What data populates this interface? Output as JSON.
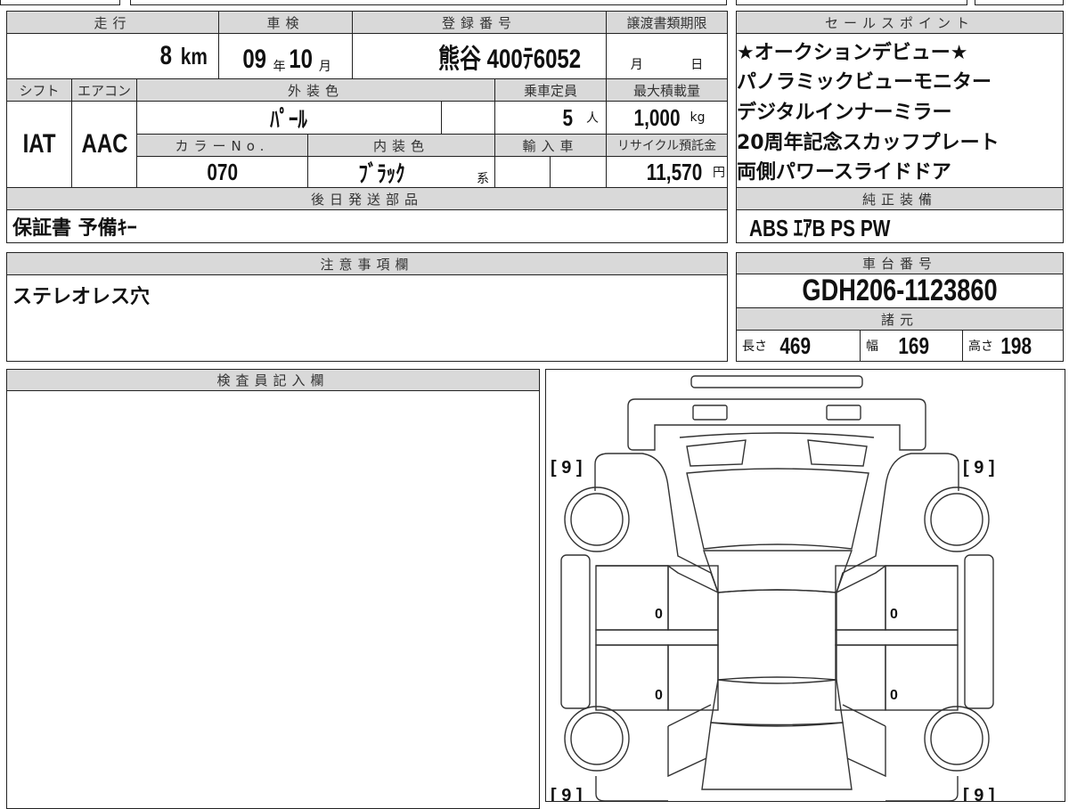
{
  "headers": {
    "mileage": "走行",
    "inspection": "車検",
    "registration": "登録番号",
    "transfer_deadline": "譲渡書類期限",
    "shift": "シフト",
    "aircon": "エアコン",
    "exterior_color": "外装色",
    "capacity": "乗車定員",
    "max_load": "最大積載量",
    "color_no": "カラーNo.",
    "interior_color": "内装色",
    "import": "輸入車",
    "recycle_fee": "リサイクル預託金",
    "parts_later": "後日発送部品",
    "sales_points": "セールスポイント",
    "genuine_equipment": "純正装備",
    "notes": "注意事項欄",
    "chassis_no": "車台番号",
    "specs": "諸元",
    "inspector": "検査員記入欄"
  },
  "values": {
    "mileage": "8",
    "mileage_unit": "km",
    "insp_year": "09",
    "year_unit": "年",
    "insp_month": "10",
    "month_unit": "月",
    "registration": "熊谷 400ﾃ6052",
    "deadline_month": "月",
    "deadline_day": "日",
    "shift": "IAT",
    "aircon": "AAC",
    "exterior_color": "ﾊﾟｰﾙ",
    "capacity": "5",
    "capacity_unit": "人",
    "max_load": "1,000",
    "max_load_unit": "kg",
    "color_no": "070",
    "interior_color": "ﾌﾞﾗｯｸ",
    "interior_suffix": "系",
    "recycle_fee": "11,570",
    "recycle_unit": "円",
    "parts_later": "保証書 予備ｷｰ",
    "notes": "ステレオレス穴",
    "chassis_no": "GDH206-1123860",
    "length_label": "長さ",
    "length": "469",
    "width_label": "幅",
    "width": "169",
    "height_label": "高さ",
    "height": "198",
    "genuine_equipment": "ABS ｴｱB PS PW"
  },
  "sales_points": [
    "★オークションデビュー★",
    "パノラミックビューモニター",
    "デジタルインナーミラー",
    "20周年記念スカッフプレート",
    "両側パワースライドドア"
  ],
  "diagram": {
    "tire_fl": "[ 9 ]",
    "tire_fr": "[ 9 ]",
    "tire_rl": "[ 9 ]",
    "tire_rr": "[ 9 ]",
    "door_fl": "0",
    "door_fr": "0",
    "door_rl": "0",
    "door_rr": "0"
  }
}
